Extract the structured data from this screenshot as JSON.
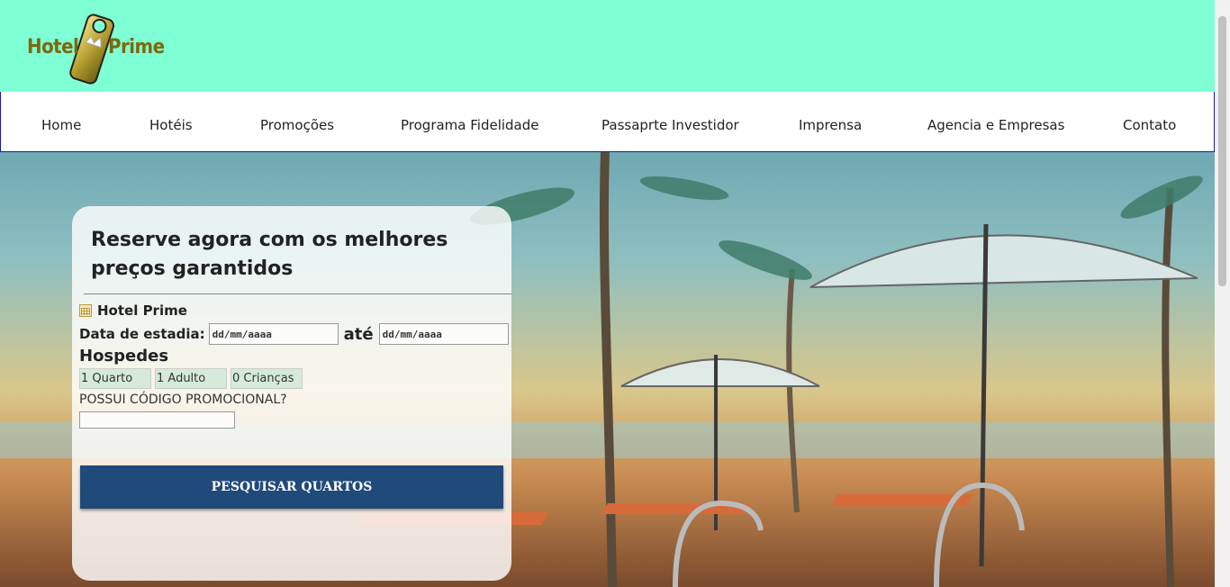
{
  "brand": {
    "word1": "Hotel",
    "word2": "Prime"
  },
  "nav": [
    "Home",
    "Hotéis",
    "Promoções",
    "Programa Fidelidade",
    "Passaprte Investidor",
    "Imprensa",
    "Agencia e Empresas",
    "Contato"
  ],
  "booking": {
    "title": "Reserve agora com os melhores preços garantidos",
    "hotel_name": "Hotel Prime",
    "date_label": "Data de estadia:",
    "date_placeholder_from": "dd/mm/aaaa",
    "until_label": "até",
    "date_placeholder_to": "dd/mm/aaaa",
    "guests_label": "Hospedes",
    "rooms": "1 Quarto",
    "adults": "1 Adulto",
    "children": "0 Crianças",
    "promo_label": "POSSUI CÓDIGO PROMOCIONAL?",
    "promo_value": "",
    "search_button": "PESQUISAR QUARTOS"
  },
  "colors": {
    "header_bg": "#7fffd4",
    "button_bg": "#1f4a7a",
    "nav_border": "#1a1aa8"
  }
}
